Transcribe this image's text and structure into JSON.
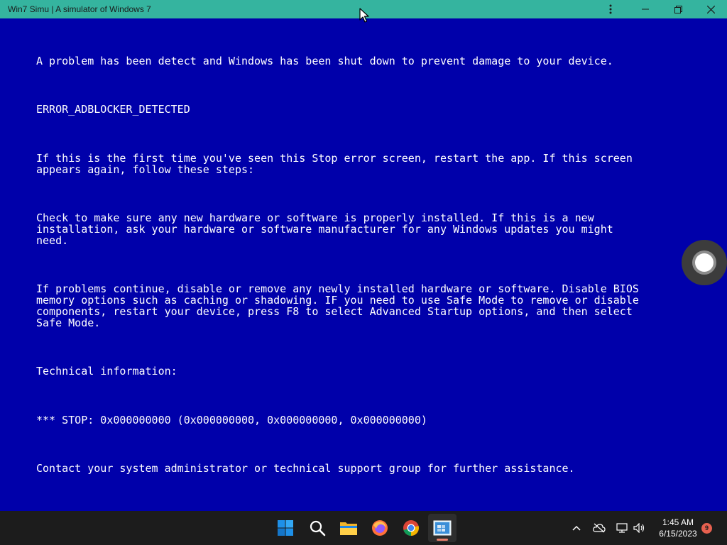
{
  "window": {
    "title": "Win7 Simu | A simulator of Windows 7",
    "titlebar_color": "#35b49f",
    "controls": {
      "more": "more-icon",
      "minimize": "minimize-icon",
      "maximize": "restore-icon",
      "close": "close-icon"
    }
  },
  "bsod": {
    "background": "#0000aa",
    "problem": "A problem has been detect and Windows has been shut down to prevent damage to your device.",
    "error_code": "ERROR_ADBLOCKER_DETECTED",
    "first_time": "If this is the first time you've seen this Stop error screen, restart the app. If this screen\nappears again, follow these steps:",
    "check": "Check to make sure any new hardware or software is properly installed. If this is a new\ninstallation, ask your hardware or software manufacturer for any Windows updates you might\nneed.",
    "continue": "If problems continue, disable or remove any newly installed hardware or software. Disable BIOS\nmemory options such as caching or shadowing. IF you need to use Safe Mode to remove or disable\ncomponents, restart your device, press F8 to select Advanced Startup options, and then select\nSafe Mode.",
    "technical_info": "Technical information:",
    "stop_code": "*** STOP: 0x000000000 (0x000000000, 0x000000000, 0x000000000)",
    "contact": "Contact your system administrator or technical support group for further assistance."
  },
  "taskbar": {
    "apps": [
      "windows-start-icon",
      "search-icon",
      "file-explorer-icon",
      "firefox-icon",
      "chrome-icon",
      "win7-simu-icon"
    ],
    "active_app": "win7-simu-icon",
    "tray": [
      "chevron-up-icon",
      "onedrive-offline-icon",
      "network-icon",
      "volume-icon"
    ],
    "time": "1:45 AM",
    "date": "6/15/2023",
    "notification_count": "9"
  }
}
